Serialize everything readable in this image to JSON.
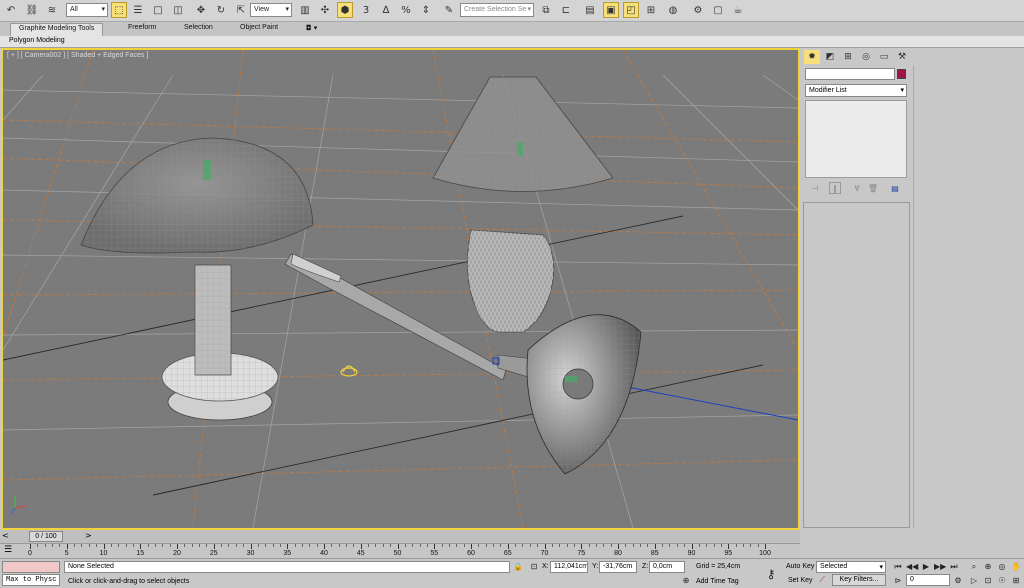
{
  "toolbar": {
    "selection_filter": "All",
    "ref_coord": "View",
    "selection_set_placeholder": "Create Selection Se",
    "snap_toggle_label": "3",
    "angle_snap_label": "∆",
    "percent_snap_label": "%"
  },
  "ribbon": {
    "tabs": [
      {
        "label": "Graphite Modeling Tools"
      },
      {
        "label": "Freeform"
      },
      {
        "label": "Selection"
      },
      {
        "label": "Object Paint"
      }
    ],
    "panel_label": "Polygon Modeling"
  },
  "viewport": {
    "label": "[ + ] [ Camera002 ] [ Shaded + Edged Faces ]",
    "background": "#7b7b7b",
    "border_color": "#f0d23c"
  },
  "command_panel": {
    "modifier_list": "Modifier List",
    "object_color": "#a0124a"
  },
  "time": {
    "frame_display": "0 / 100",
    "ticks": [
      "0",
      "5",
      "10",
      "15",
      "20",
      "25",
      "30",
      "35",
      "40",
      "45",
      "50",
      "55",
      "60",
      "65",
      "70",
      "75",
      "80",
      "85",
      "90",
      "95",
      "100"
    ]
  },
  "status": {
    "maxscript": "Max to Physc",
    "selection": "None Selected",
    "prompt": "Click or click-and-drag to select objects",
    "x_label": "X:",
    "x_value": "112,041cm",
    "y_label": "Y:",
    "y_value": "-31,76cm",
    "z_label": "Z:",
    "z_value": "0,0cm",
    "grid": "Grid = 25,4cm",
    "add_time_tag": "Add Time Tag",
    "auto_key": "Auto Key",
    "set_key": "Set Key",
    "key_mode": "Selected",
    "key_filters": "Key Filters...",
    "current_frame": "0"
  }
}
